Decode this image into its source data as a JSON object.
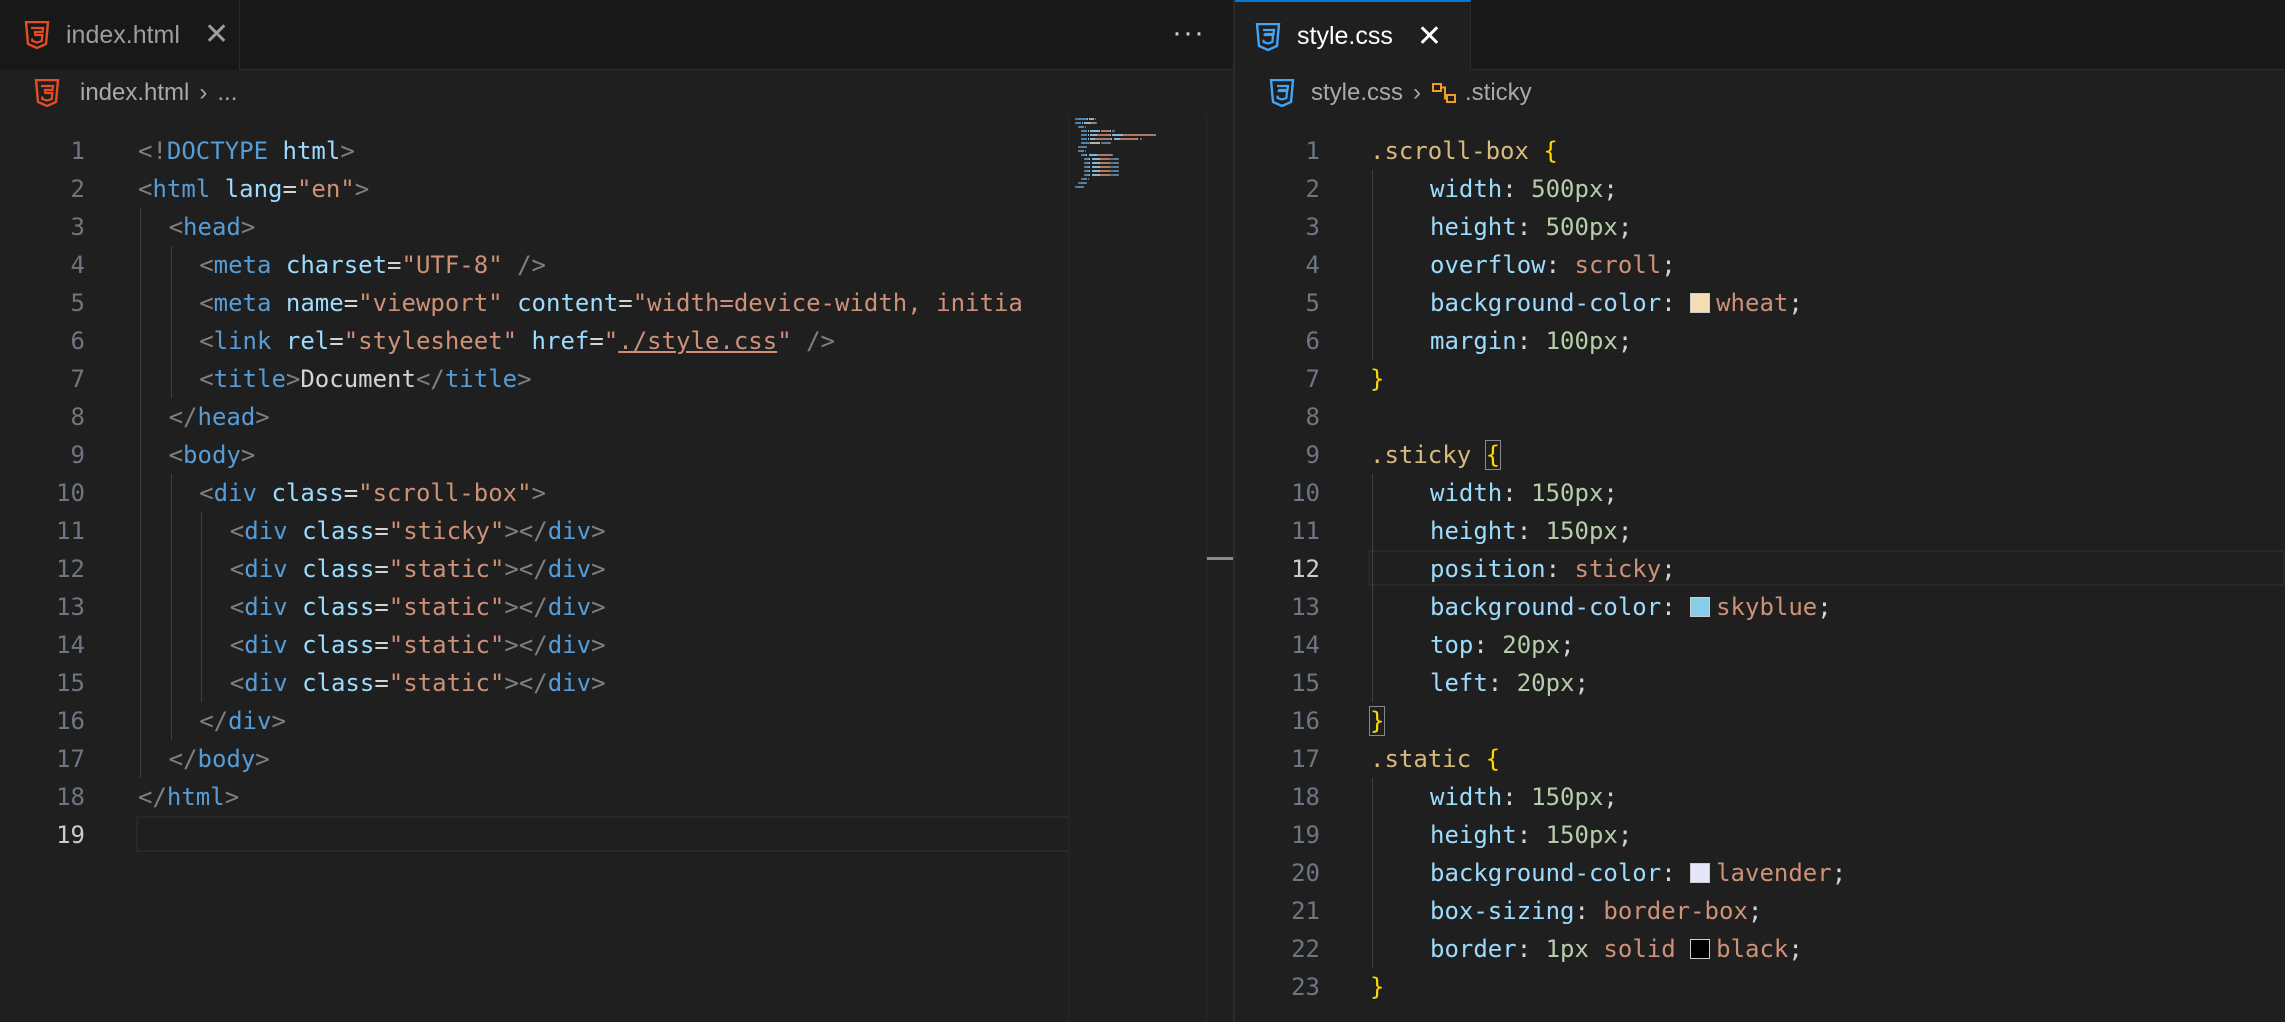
{
  "left_pane": {
    "tab": {
      "label": "index.html",
      "close": "✕",
      "icon": "html5-icon"
    },
    "more_actions": "···",
    "breadcrumb": {
      "file": "index.html",
      "sep": "›",
      "rest": "..."
    },
    "active_line": 19,
    "lines": [
      {
        "n": "1",
        "indent": 0,
        "tokens": [
          [
            "p",
            "<!"
          ],
          [
            "t",
            "DOCTYPE"
          ],
          [
            "x",
            " "
          ],
          [
            "a",
            "html"
          ],
          [
            "p",
            ">"
          ]
        ]
      },
      {
        "n": "2",
        "indent": 0,
        "tokens": [
          [
            "p",
            "<"
          ],
          [
            "t",
            "html"
          ],
          [
            "x",
            " "
          ],
          [
            "a",
            "lang"
          ],
          [
            "x",
            "="
          ],
          [
            "s",
            "\"en\""
          ],
          [
            "p",
            ">"
          ]
        ]
      },
      {
        "n": "3",
        "indent": 1,
        "tokens": [
          [
            "p",
            "<"
          ],
          [
            "t",
            "head"
          ],
          [
            "p",
            ">"
          ]
        ]
      },
      {
        "n": "4",
        "indent": 2,
        "tokens": [
          [
            "p",
            "<"
          ],
          [
            "t",
            "meta"
          ],
          [
            "x",
            " "
          ],
          [
            "a",
            "charset"
          ],
          [
            "x",
            "="
          ],
          [
            "s",
            "\"UTF-8\""
          ],
          [
            "x",
            " "
          ],
          [
            "p",
            "/>"
          ]
        ]
      },
      {
        "n": "5",
        "indent": 2,
        "tokens": [
          [
            "p",
            "<"
          ],
          [
            "t",
            "meta"
          ],
          [
            "x",
            " "
          ],
          [
            "a",
            "name"
          ],
          [
            "x",
            "="
          ],
          [
            "s",
            "\"viewport\""
          ],
          [
            "x",
            " "
          ],
          [
            "a",
            "content"
          ],
          [
            "x",
            "="
          ],
          [
            "s",
            "\"width=device-width, initia"
          ]
        ]
      },
      {
        "n": "6",
        "indent": 2,
        "tokens": [
          [
            "p",
            "<"
          ],
          [
            "t",
            "link"
          ],
          [
            "x",
            " "
          ],
          [
            "a",
            "rel"
          ],
          [
            "x",
            "="
          ],
          [
            "s",
            "\"stylesheet\""
          ],
          [
            "x",
            " "
          ],
          [
            "a",
            "href"
          ],
          [
            "x",
            "="
          ],
          [
            "s",
            "\""
          ],
          [
            "u",
            "./style.css"
          ],
          [
            "s",
            "\""
          ],
          [
            "x",
            " "
          ],
          [
            "p",
            "/>"
          ]
        ]
      },
      {
        "n": "7",
        "indent": 2,
        "tokens": [
          [
            "p",
            "<"
          ],
          [
            "t",
            "title"
          ],
          [
            "p",
            ">"
          ],
          [
            "x",
            "Document"
          ],
          [
            "p",
            "</"
          ],
          [
            "t",
            "title"
          ],
          [
            "p",
            ">"
          ]
        ]
      },
      {
        "n": "8",
        "indent": 1,
        "tokens": [
          [
            "p",
            "</"
          ],
          [
            "t",
            "head"
          ],
          [
            "p",
            ">"
          ]
        ]
      },
      {
        "n": "9",
        "indent": 1,
        "tokens": [
          [
            "p",
            "<"
          ],
          [
            "t",
            "body"
          ],
          [
            "p",
            ">"
          ]
        ]
      },
      {
        "n": "10",
        "indent": 2,
        "tokens": [
          [
            "p",
            "<"
          ],
          [
            "t",
            "div"
          ],
          [
            "x",
            " "
          ],
          [
            "a",
            "class"
          ],
          [
            "x",
            "="
          ],
          [
            "s",
            "\"scroll-box\""
          ],
          [
            "p",
            ">"
          ]
        ]
      },
      {
        "n": "11",
        "indent": 3,
        "tokens": [
          [
            "p",
            "<"
          ],
          [
            "t",
            "div"
          ],
          [
            "x",
            " "
          ],
          [
            "a",
            "class"
          ],
          [
            "x",
            "="
          ],
          [
            "s",
            "\"sticky\""
          ],
          [
            "p",
            "></"
          ],
          [
            "t",
            "div"
          ],
          [
            "p",
            ">"
          ]
        ]
      },
      {
        "n": "12",
        "indent": 3,
        "tokens": [
          [
            "p",
            "<"
          ],
          [
            "t",
            "div"
          ],
          [
            "x",
            " "
          ],
          [
            "a",
            "class"
          ],
          [
            "x",
            "="
          ],
          [
            "s",
            "\"static\""
          ],
          [
            "p",
            "></"
          ],
          [
            "t",
            "div"
          ],
          [
            "p",
            ">"
          ]
        ]
      },
      {
        "n": "13",
        "indent": 3,
        "tokens": [
          [
            "p",
            "<"
          ],
          [
            "t",
            "div"
          ],
          [
            "x",
            " "
          ],
          [
            "a",
            "class"
          ],
          [
            "x",
            "="
          ],
          [
            "s",
            "\"static\""
          ],
          [
            "p",
            "></"
          ],
          [
            "t",
            "div"
          ],
          [
            "p",
            ">"
          ]
        ]
      },
      {
        "n": "14",
        "indent": 3,
        "tokens": [
          [
            "p",
            "<"
          ],
          [
            "t",
            "div"
          ],
          [
            "x",
            " "
          ],
          [
            "a",
            "class"
          ],
          [
            "x",
            "="
          ],
          [
            "s",
            "\"static\""
          ],
          [
            "p",
            "></"
          ],
          [
            "t",
            "div"
          ],
          [
            "p",
            ">"
          ]
        ]
      },
      {
        "n": "15",
        "indent": 3,
        "tokens": [
          [
            "p",
            "<"
          ],
          [
            "t",
            "div"
          ],
          [
            "x",
            " "
          ],
          [
            "a",
            "class"
          ],
          [
            "x",
            "="
          ],
          [
            "s",
            "\"static\""
          ],
          [
            "p",
            "></"
          ],
          [
            "t",
            "div"
          ],
          [
            "p",
            ">"
          ]
        ]
      },
      {
        "n": "16",
        "indent": 2,
        "tokens": [
          [
            "p",
            "</"
          ],
          [
            "t",
            "div"
          ],
          [
            "p",
            ">"
          ]
        ]
      },
      {
        "n": "17",
        "indent": 1,
        "tokens": [
          [
            "p",
            "</"
          ],
          [
            "t",
            "body"
          ],
          [
            "p",
            ">"
          ]
        ]
      },
      {
        "n": "18",
        "indent": 0,
        "tokens": [
          [
            "p",
            "</"
          ],
          [
            "t",
            "html"
          ],
          [
            "p",
            ">"
          ]
        ]
      },
      {
        "n": "19",
        "indent": 0,
        "tokens": []
      }
    ]
  },
  "right_pane": {
    "tab": {
      "label": "style.css",
      "close": "✕",
      "icon": "css3-icon"
    },
    "breadcrumb": {
      "file": "style.css",
      "sep": "›",
      "symbol": ".sticky",
      "symbol_icon": "class-symbol-icon"
    },
    "active_line": 12,
    "lines": [
      {
        "n": "1",
        "indent": 0,
        "tokens": [
          [
            "sel",
            ".scroll-box"
          ],
          [
            "x",
            " "
          ],
          [
            "b",
            "{"
          ]
        ]
      },
      {
        "n": "2",
        "indent": 1,
        "tokens": [
          [
            "pr",
            "width"
          ],
          [
            "x",
            ": "
          ],
          [
            "num",
            "500px"
          ],
          [
            "x",
            ";"
          ]
        ]
      },
      {
        "n": "3",
        "indent": 1,
        "tokens": [
          [
            "pr",
            "height"
          ],
          [
            "x",
            ": "
          ],
          [
            "num",
            "500px"
          ],
          [
            "x",
            ";"
          ]
        ]
      },
      {
        "n": "4",
        "indent": 1,
        "tokens": [
          [
            "pr",
            "overflow"
          ],
          [
            "x",
            ": "
          ],
          [
            "v",
            "scroll"
          ],
          [
            "x",
            ";"
          ]
        ]
      },
      {
        "n": "5",
        "indent": 1,
        "tokens": [
          [
            "pr",
            "background-color"
          ],
          [
            "x",
            ": "
          ],
          [
            "sw",
            "#f5deb3"
          ],
          [
            "v",
            "wheat"
          ],
          [
            "x",
            ";"
          ]
        ]
      },
      {
        "n": "6",
        "indent": 1,
        "tokens": [
          [
            "pr",
            "margin"
          ],
          [
            "x",
            ": "
          ],
          [
            "num",
            "100px"
          ],
          [
            "x",
            ";"
          ]
        ]
      },
      {
        "n": "7",
        "indent": 0,
        "tokens": [
          [
            "b",
            "}"
          ]
        ]
      },
      {
        "n": "8",
        "indent": 0,
        "tokens": []
      },
      {
        "n": "9",
        "indent": 0,
        "tokens": [
          [
            "sel",
            ".sticky"
          ],
          [
            "x",
            " "
          ],
          [
            "bm",
            "{"
          ]
        ]
      },
      {
        "n": "10",
        "indent": 1,
        "tokens": [
          [
            "pr",
            "width"
          ],
          [
            "x",
            ": "
          ],
          [
            "num",
            "150px"
          ],
          [
            "x",
            ";"
          ]
        ]
      },
      {
        "n": "11",
        "indent": 1,
        "tokens": [
          [
            "pr",
            "height"
          ],
          [
            "x",
            ": "
          ],
          [
            "num",
            "150px"
          ],
          [
            "x",
            ";"
          ]
        ]
      },
      {
        "n": "12",
        "indent": 1,
        "tokens": [
          [
            "pr",
            "position"
          ],
          [
            "x",
            ": "
          ],
          [
            "v",
            "sticky"
          ],
          [
            "x",
            ";"
          ]
        ]
      },
      {
        "n": "13",
        "indent": 1,
        "tokens": [
          [
            "pr",
            "background-color"
          ],
          [
            "x",
            ": "
          ],
          [
            "sw",
            "#87ceeb"
          ],
          [
            "v",
            "skyblue"
          ],
          [
            "x",
            ";"
          ]
        ]
      },
      {
        "n": "14",
        "indent": 1,
        "tokens": [
          [
            "pr",
            "top"
          ],
          [
            "x",
            ": "
          ],
          [
            "num",
            "20px"
          ],
          [
            "x",
            ";"
          ]
        ]
      },
      {
        "n": "15",
        "indent": 1,
        "tokens": [
          [
            "pr",
            "left"
          ],
          [
            "x",
            ": "
          ],
          [
            "num",
            "20px"
          ],
          [
            "x",
            ";"
          ]
        ]
      },
      {
        "n": "16",
        "indent": 0,
        "tokens": [
          [
            "bm",
            "}"
          ]
        ]
      },
      {
        "n": "17",
        "indent": 0,
        "tokens": [
          [
            "sel",
            ".static"
          ],
          [
            "x",
            " "
          ],
          [
            "b",
            "{"
          ]
        ]
      },
      {
        "n": "18",
        "indent": 1,
        "tokens": [
          [
            "pr",
            "width"
          ],
          [
            "x",
            ": "
          ],
          [
            "num",
            "150px"
          ],
          [
            "x",
            ";"
          ]
        ]
      },
      {
        "n": "19",
        "indent": 1,
        "tokens": [
          [
            "pr",
            "height"
          ],
          [
            "x",
            ": "
          ],
          [
            "num",
            "150px"
          ],
          [
            "x",
            ";"
          ]
        ]
      },
      {
        "n": "20",
        "indent": 1,
        "tokens": [
          [
            "pr",
            "background-color"
          ],
          [
            "x",
            ": "
          ],
          [
            "sw",
            "#e6e6fa"
          ],
          [
            "v",
            "lavender"
          ],
          [
            "x",
            ";"
          ]
        ]
      },
      {
        "n": "21",
        "indent": 1,
        "tokens": [
          [
            "pr",
            "box-sizing"
          ],
          [
            "x",
            ": "
          ],
          [
            "v",
            "border-box"
          ],
          [
            "x",
            ";"
          ]
        ]
      },
      {
        "n": "22",
        "indent": 1,
        "tokens": [
          [
            "pr",
            "border"
          ],
          [
            "x",
            ": "
          ],
          [
            "num",
            "1px"
          ],
          [
            "x",
            " "
          ],
          [
            "v",
            "solid"
          ],
          [
            "x",
            " "
          ],
          [
            "sw",
            "#000000"
          ],
          [
            "v",
            "black"
          ],
          [
            "x",
            ";"
          ]
        ]
      },
      {
        "n": "23",
        "indent": 0,
        "tokens": [
          [
            "b",
            "}"
          ]
        ]
      }
    ]
  },
  "colors": {
    "accent": "#0078d4",
    "html_icon": "#e44d26",
    "css_icon": "#42a5f5",
    "editor_bg": "#1f1f1f"
  }
}
